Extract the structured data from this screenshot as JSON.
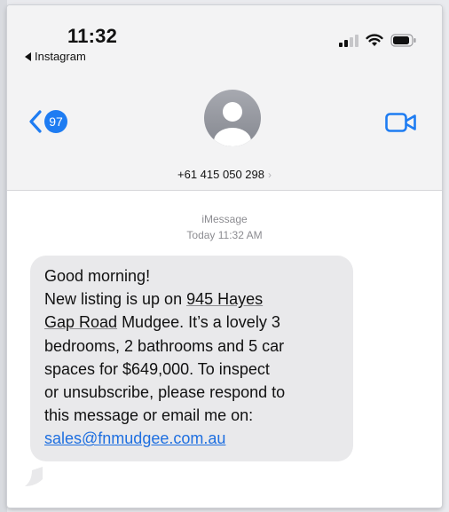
{
  "status_bar": {
    "time": "11:32",
    "back_app": "Instagram"
  },
  "header": {
    "unread_count": "97",
    "contact_number": "+61 415 050 298",
    "contact_chevron": "›"
  },
  "conversation": {
    "service": "iMessage",
    "timestamp": "Today 11:32 AM"
  },
  "message": {
    "line1": "Good morning!",
    "line2_pre": "New listing is up on ",
    "line2_link": "945 Hayes",
    "line3_link": "Gap Road",
    "line3_post": " Mudgee. It’s a lovely 3",
    "line4": "bedrooms, 2 bathrooms and 5 car",
    "line5": "spaces for $649,000. To inspect",
    "line6": "or unsubscribe, please respond to",
    "line7": "this message or email me on:",
    "email": "sales@fnmudgee.com.au"
  },
  "colors": {
    "accent": "#1e7cf2",
    "bubble_bg": "#e9e9eb",
    "header_bg": "#f3f3f4"
  },
  "icons": [
    "back-chevron-icon",
    "video-camera-icon",
    "contact-avatar-icon",
    "cellular-signal-icon",
    "wifi-icon",
    "battery-icon"
  ]
}
